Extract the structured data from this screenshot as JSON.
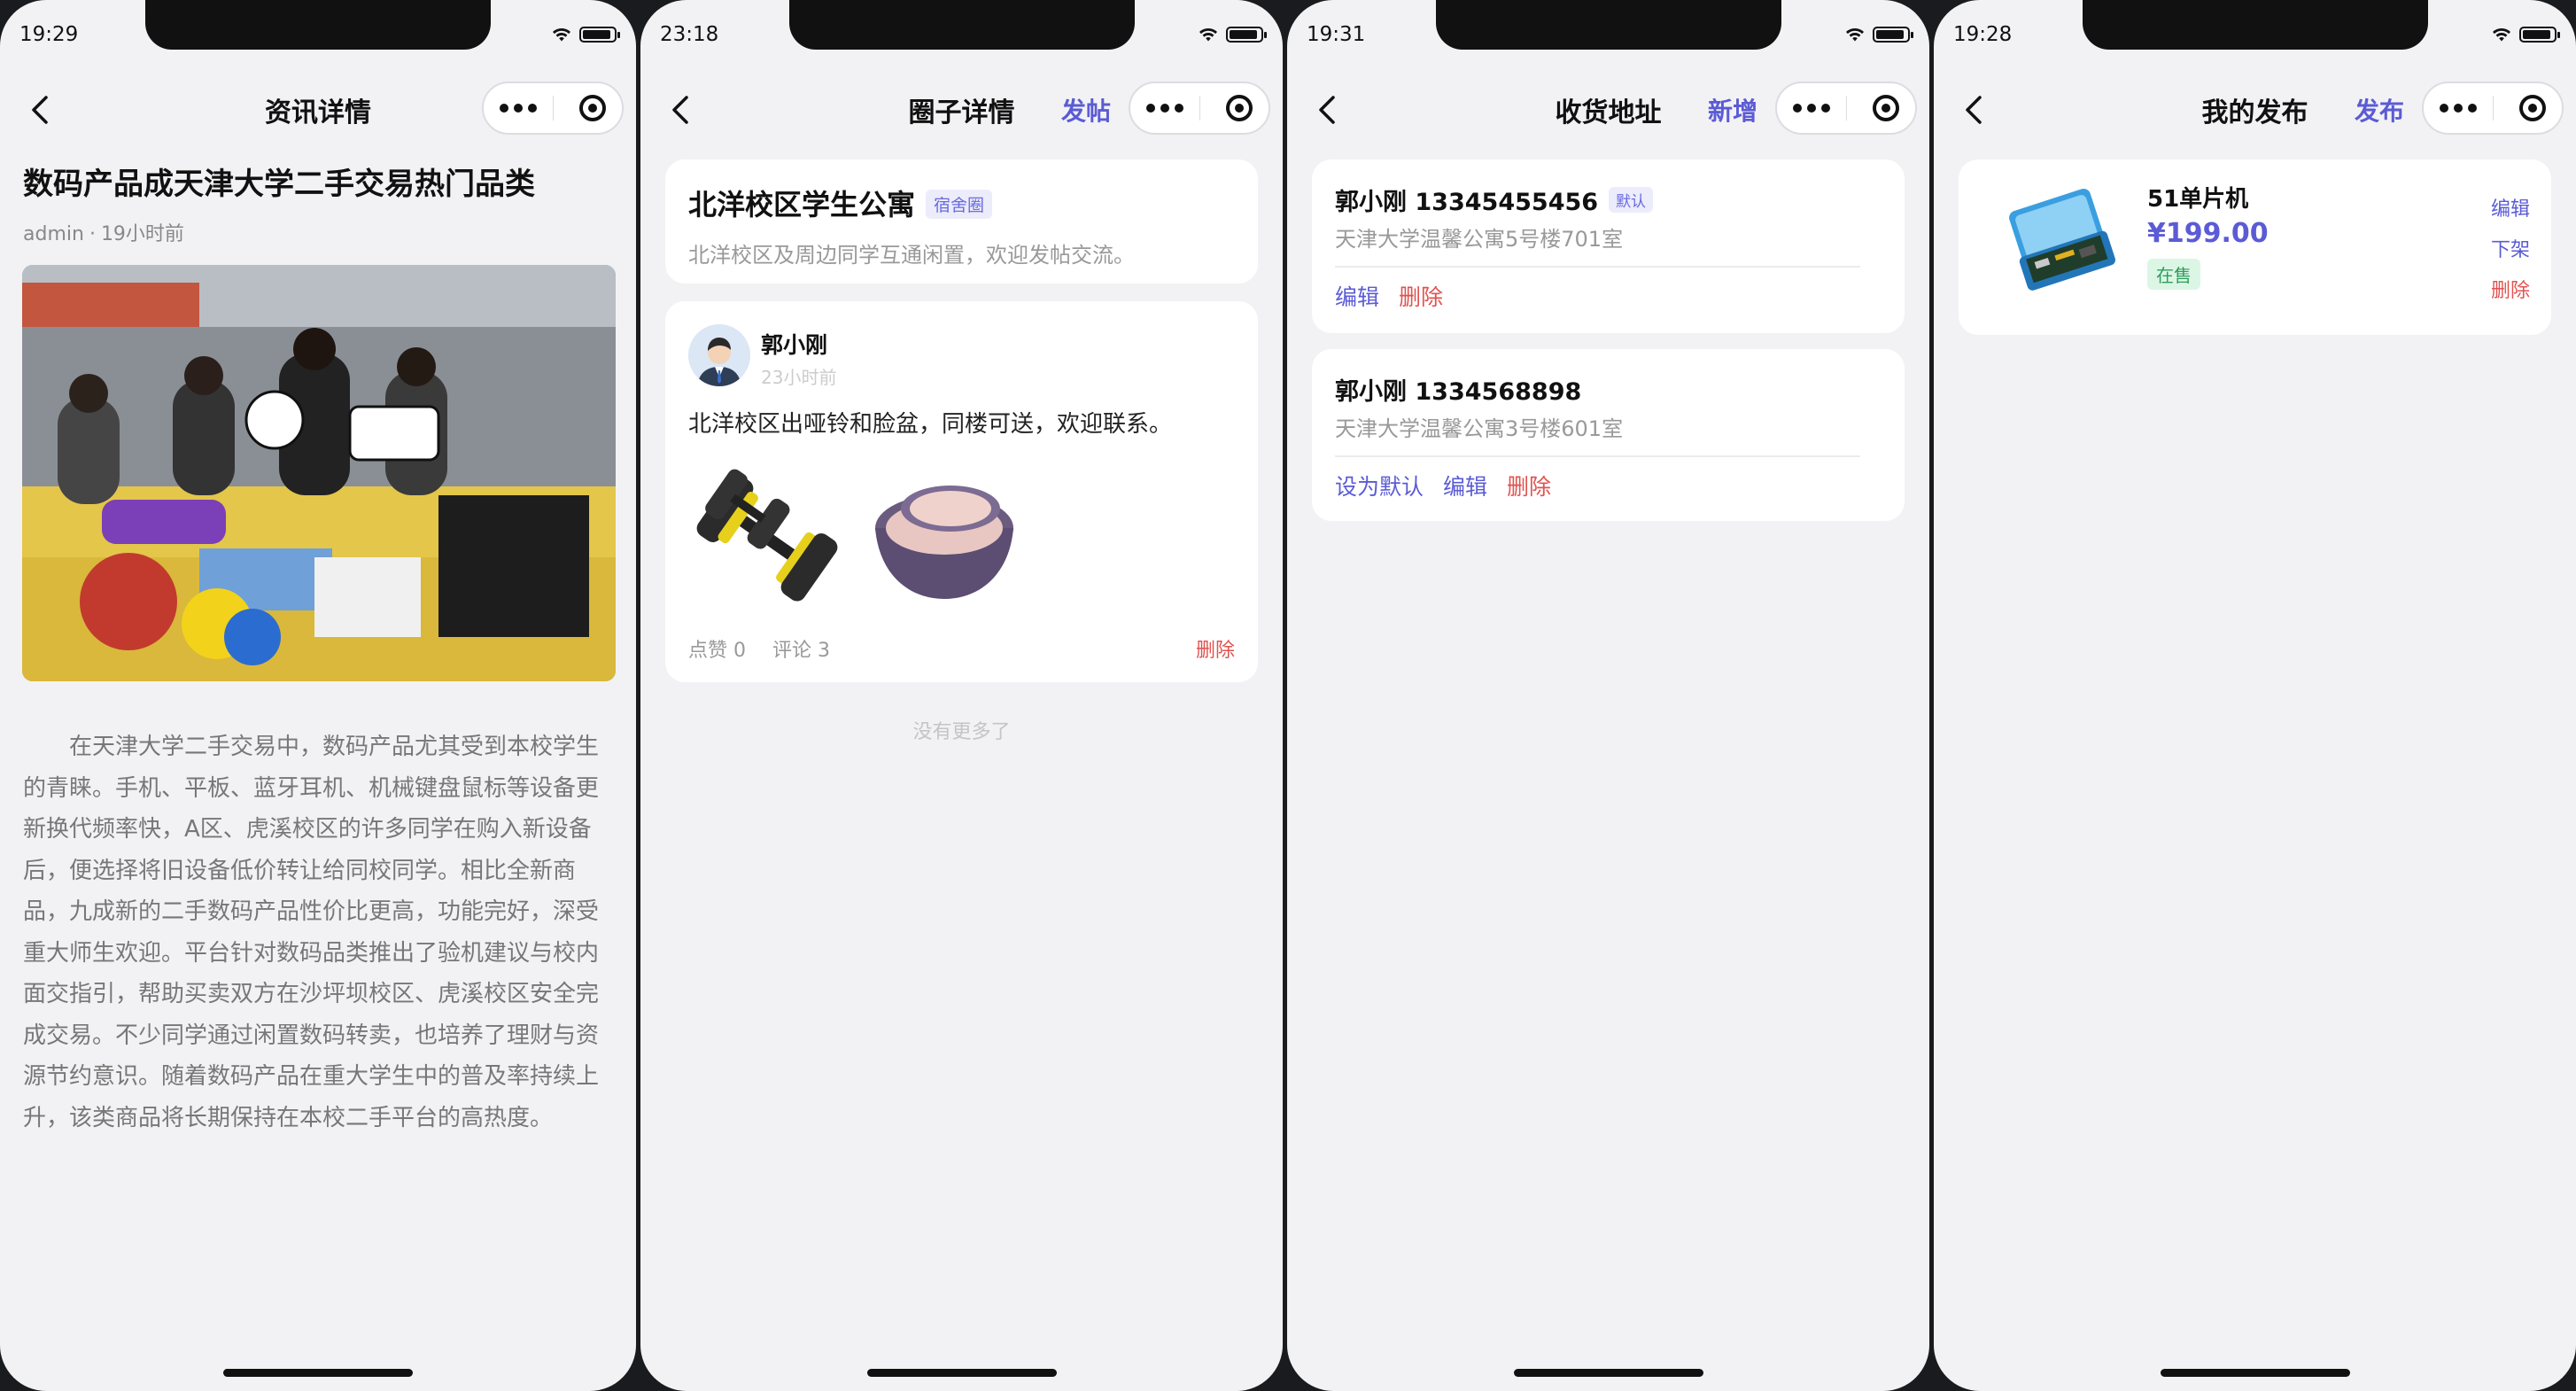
{
  "colors": {
    "accent": "#5b5bd6",
    "danger": "#e0524f",
    "success": "#2e9d5b",
    "background": "#f2f2f4"
  },
  "screens": [
    {
      "status_time": "19:29",
      "nav_title": "资讯详情",
      "article": {
        "title": "数码产品成天津大学二手交易热门品类",
        "author": "admin",
        "meta_sep": "·",
        "time": "19小时前",
        "image": "campus-flea-market-photo",
        "body": "在天津大学二手交易中，数码产品尤其受到本校学生的青睐。手机、平板、蓝牙耳机、机械键盘鼠标等设备更新换代频率快，A区、虎溪校区的许多同学在购入新设备后，便选择将旧设备低价转让给同校同学。相比全新商品，九成新的二手数码产品性价比更高，功能完好，深受重大师生欢迎。平台针对数码品类推出了验机建议与校内面交指引，帮助买卖双方在沙坪坝校区、虎溪校区安全完成交易。不少同学通过闲置数码转卖，也培养了理财与资源节约意识。随着数码产品在重大学生中的普及率持续上升，该类商品将长期保持在本校二手平台的高热度。"
      }
    },
    {
      "status_time": "23:18",
      "nav_title": "圈子详情",
      "nav_action": "发帖",
      "circle": {
        "name": "北洋校区学生公寓",
        "tag": "宿舍圈",
        "desc": "北洋校区及周边同学互通闲置，欢迎发帖交流。"
      },
      "post": {
        "author": "郭小刚",
        "time": "23小时前",
        "text": "北洋校区出哑铃和脸盆，同楼可送，欢迎联系。",
        "images": [
          "dumbbell-photo",
          "washbasin-photo"
        ],
        "likes": "点赞 0",
        "comments": "评论 3",
        "delete": "删除"
      },
      "no_more": "没有更多了"
    },
    {
      "status_time": "19:31",
      "nav_title": "收货地址",
      "nav_action": "新增",
      "addresses": [
        {
          "name_phone": "郭小刚 13345455456",
          "badge": "默认",
          "detail": "天津大学温馨公寓5号楼701室",
          "edit": "编辑",
          "delete": "删除"
        },
        {
          "name_phone": "郭小刚 1334568898",
          "set_default": "设为默认",
          "detail": "天津大学温馨公寓3号楼601室",
          "edit": "编辑",
          "delete": "删除"
        }
      ]
    },
    {
      "status_time": "19:28",
      "nav_title": "我的发布",
      "nav_action": "发布",
      "product": {
        "title": "51单片机",
        "price": "¥199.00",
        "status": "在售",
        "image": "microcontroller-kit-photo",
        "edit": "编辑",
        "offshelf": "下架",
        "delete": "删除"
      }
    }
  ]
}
